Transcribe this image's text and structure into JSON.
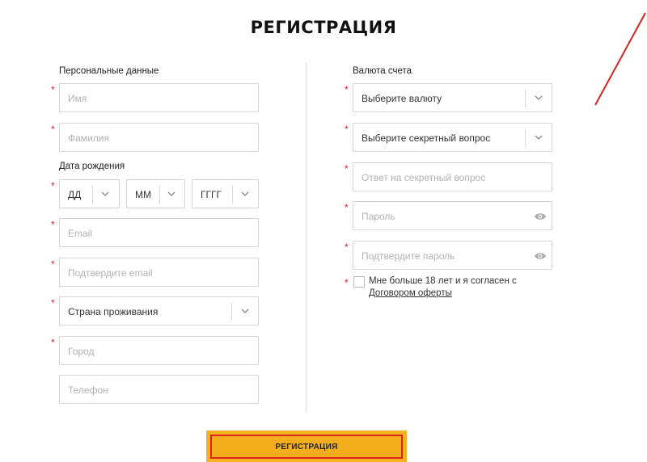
{
  "page": {
    "title": "РЕГИСТРАЦИЯ"
  },
  "left": {
    "personal_label": "Персональные данные",
    "name_placeholder": "Имя",
    "surname_placeholder": "Фамилия",
    "birth_label": "Дата рождения",
    "day_value": "ДД",
    "month_value": "ММ",
    "year_value": "ГГГГ",
    "email_placeholder": "Email",
    "confirm_email_placeholder": "Подтвердите email",
    "country_value": "Страна проживания",
    "city_placeholder": "Город",
    "phone_placeholder": "Телефон"
  },
  "right": {
    "currency_label": "Валюта счета",
    "currency_value": "Выберите валюту",
    "secret_question_value": "Выберите секретный вопрос",
    "secret_answer_placeholder": "Ответ на секретный вопрос",
    "password_placeholder": "Пароль",
    "confirm_password_placeholder": "Подтвердите пароль",
    "agree_text": "Мне больше 18 лет и я согласен с ",
    "agree_link": "Договором оферты"
  },
  "required_mark": "*",
  "submit_label": "РЕГИСТРАЦИЯ",
  "colors": {
    "accent": "#f4ae1b",
    "required": "#dd2222",
    "annotation": "#d22222"
  },
  "icons": {
    "dropdown": "chevron-down-icon",
    "password": "eye-icon"
  }
}
